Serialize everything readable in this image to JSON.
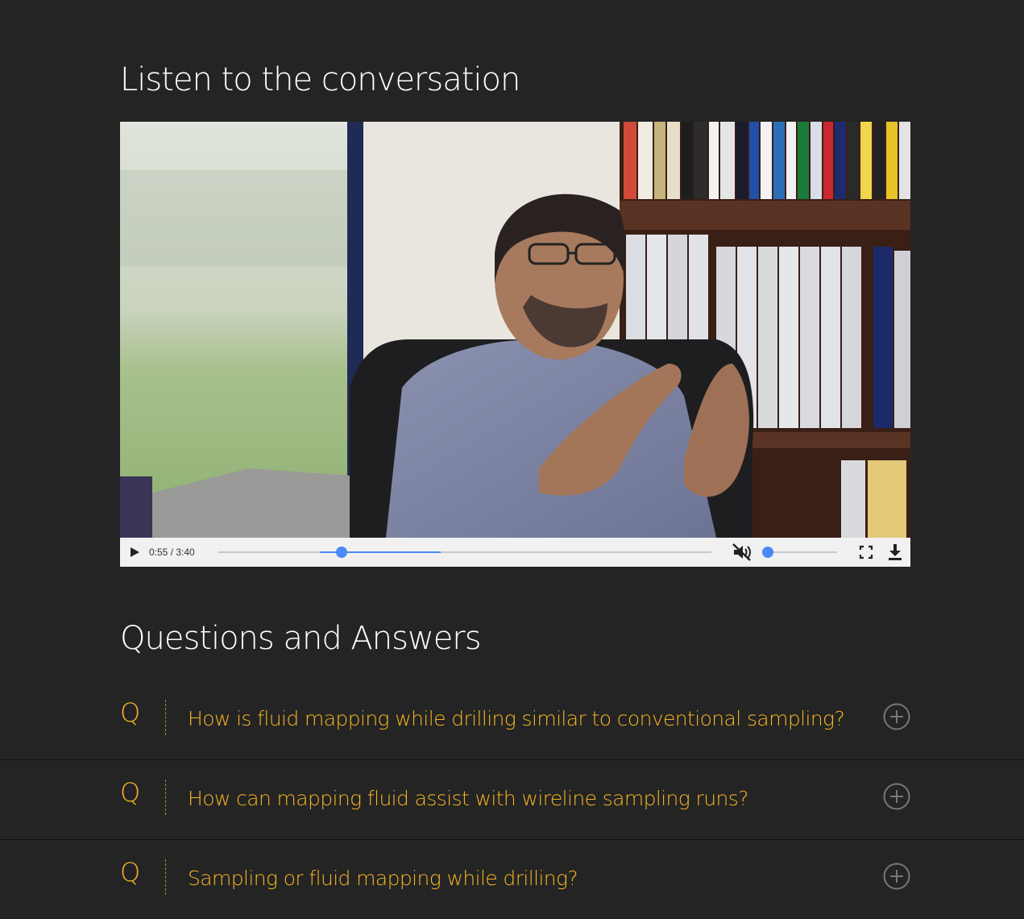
{
  "page": {
    "video_section_title": "Listen to the conversation",
    "qa_section_title": "Questions and Answers"
  },
  "video": {
    "current_time": "0:55",
    "duration": "3:40",
    "time_display": "0:55 / 3:40",
    "progress_fraction": 0.25,
    "volume_fraction": 0.0,
    "muted": true,
    "accent_color": "#4a8af4",
    "icons": [
      "play-icon",
      "mute-icon",
      "fullscreen-icon",
      "download-icon"
    ]
  },
  "qa": {
    "prefix": "Q",
    "accent_color": "#f5b524",
    "items": [
      {
        "question": "How is fluid mapping while drilling similar to conventional sampling?",
        "icon": "plus-circle-icon"
      },
      {
        "question": "How can mapping fluid assist with wireline sampling runs?",
        "icon": "plus-circle-icon"
      },
      {
        "question": "Sampling or fluid mapping while drilling?",
        "icon": "plus-circle-icon"
      }
    ]
  }
}
